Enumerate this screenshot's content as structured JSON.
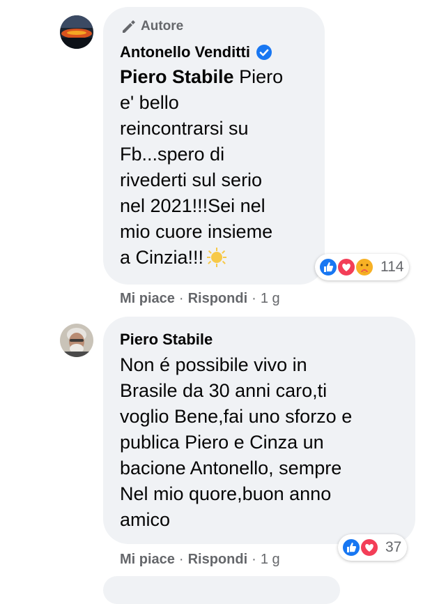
{
  "comment1": {
    "badge_label": "Autore",
    "author": "Antonello Venditti",
    "mention": "Piero Stabile",
    "lines_first": " Piero",
    "lines": [
      "e' bello",
      "reincontrarsi su",
      "Fb...spero di",
      "rivederti sul serio",
      "nel 2021!!!Sei nel",
      "mio cuore insieme"
    ],
    "last_line": "a Cinzia!!!",
    "reaction_icons": [
      "like-icon",
      "love-icon",
      "care-icon"
    ],
    "reaction_count": "114",
    "like_label": "Mi piace",
    "reply_label": "Rispondi",
    "time": "1 g"
  },
  "comment2": {
    "author": "Piero Stabile",
    "lines": [
      "Non é possibile vivo in",
      "Brasile da 30 anni caro,ti",
      "voglio Bene,fai uno sforzo e",
      "publica Piero e Cinza un",
      "bacione Antonello, sempre",
      "Nel mio quore,buon anno",
      "amico"
    ],
    "reaction_icons": [
      "like-icon",
      "love-icon"
    ],
    "reaction_count": "37",
    "like_label": "Mi piace",
    "reply_label": "Rispondi",
    "time": "1 g"
  },
  "separator": "·",
  "colors": {
    "bubble": "#f0f2f5",
    "meta": "#65676b",
    "like_blue": "#1877f2",
    "love_red": "#f33e58",
    "verified": "#1877f2"
  }
}
